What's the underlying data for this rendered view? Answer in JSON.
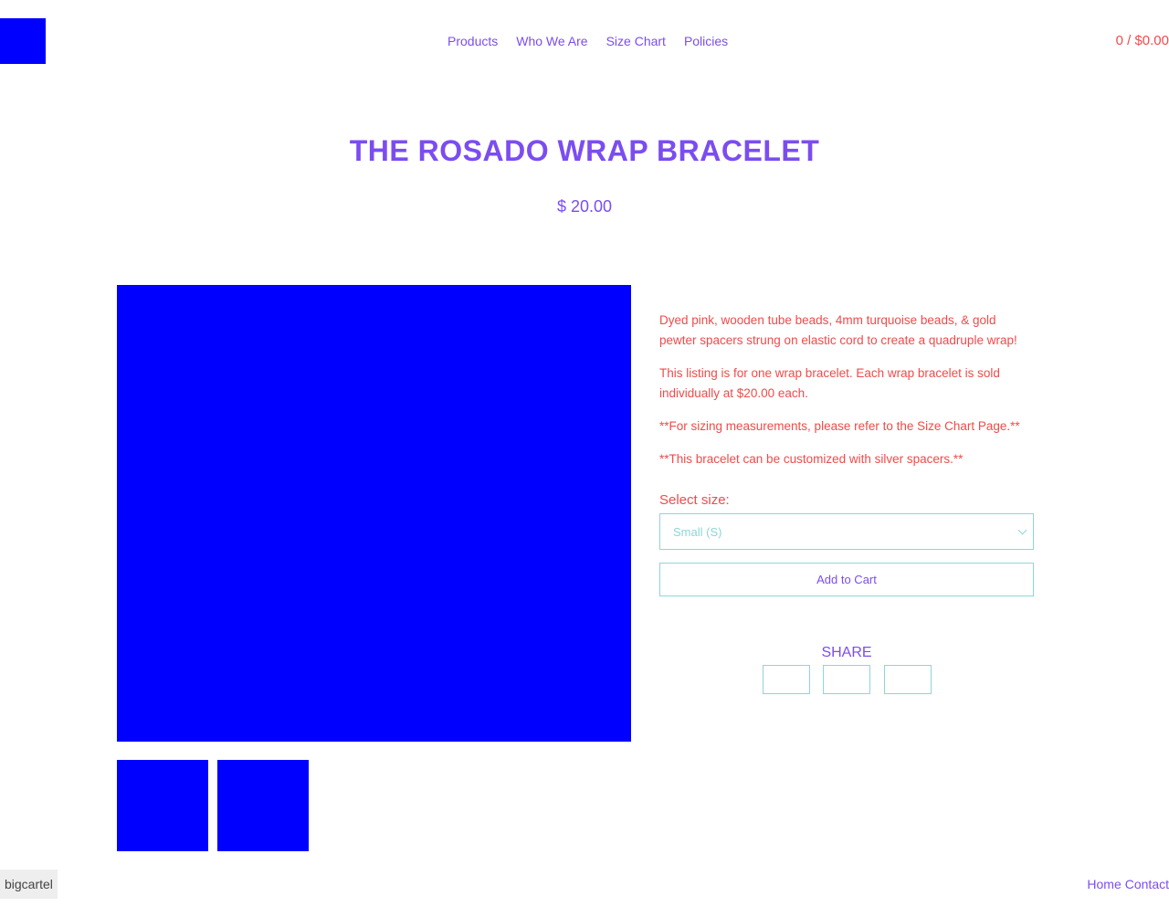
{
  "colors": {
    "accent": "#7b4df0",
    "text": "#f24a4a",
    "border": "#8ed6d6",
    "image_placeholder": "#0000ff"
  },
  "header": {
    "nav": [
      "Products",
      "Who We Are",
      "Size Chart",
      "Policies"
    ],
    "cart": "0 / $0.00"
  },
  "product": {
    "title": "THE ROSADO WRAP BRACELET",
    "price": "$ 20.00",
    "description": [
      "Dyed pink, wooden tube beads, 4mm turquoise beads, & gold pewter spacers strung on elastic cord to create a quadruple wrap!",
      "This listing is for one wrap bracelet. Each wrap bracelet is sold individually at $20.00 each.",
      "**For sizing measurements, please refer to the Size Chart Page.**",
      "**This bracelet can be customized with silver spacers.**"
    ],
    "size_label": "Select size:",
    "size_selected": "Small (S)",
    "add_to_cart": "Add to Cart",
    "share_label": "SHARE"
  },
  "footer": {
    "badge": "bigcartel",
    "links": [
      "Home",
      "Contact"
    ]
  }
}
